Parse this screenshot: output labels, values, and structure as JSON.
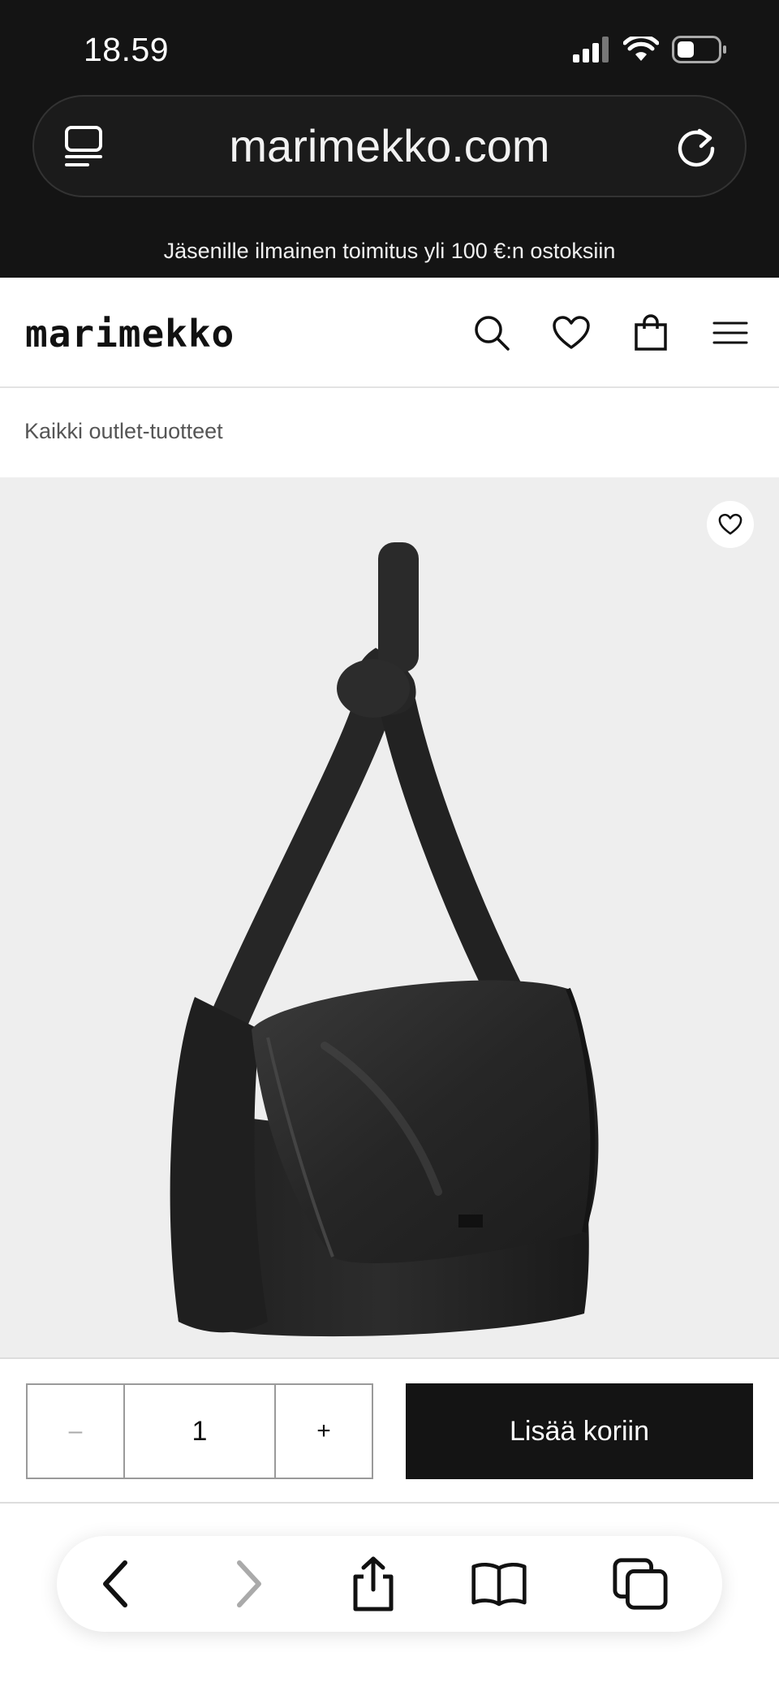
{
  "status_bar": {
    "time": "18.59",
    "icons": [
      "cellular-signal-icon",
      "wifi-icon",
      "battery-icon"
    ]
  },
  "browser": {
    "url": "marimekko.com",
    "icons": [
      "tab-overview-icon",
      "reload-icon"
    ]
  },
  "promo_banner": {
    "text": "Jäsenille ilmainen toimitus yli 100 €:n ostoksiin"
  },
  "header": {
    "logo": "marimekko",
    "icons": [
      "search-icon",
      "heart-icon",
      "shopping-bag-icon",
      "menu-icon"
    ]
  },
  "breadcrumb": {
    "label": "Kaikki outlet-tuotteet"
  },
  "product": {
    "image_icon": "black-padded-shoulder-bag",
    "wishlist_icon": "heart-icon"
  },
  "cart": {
    "minus_label": "–",
    "quantity": "1",
    "plus_label": "+",
    "add_to_cart_label": "Lisää koriin"
  },
  "toolbar": {
    "icons": [
      "back-icon",
      "forward-icon",
      "share-icon",
      "bookmarks-icon",
      "tabs-icon"
    ]
  },
  "colors": {
    "browser_chrome": "#141414",
    "product_bg": "#eeeeee",
    "button_dark": "#141414"
  }
}
